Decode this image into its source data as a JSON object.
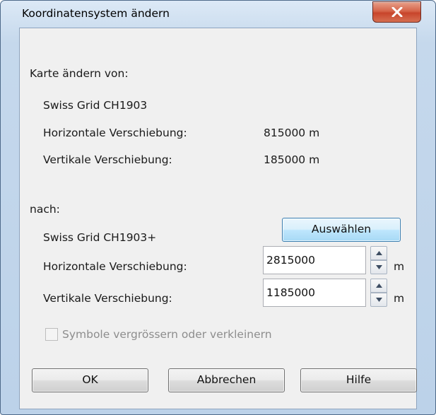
{
  "window": {
    "title": "Koordinatensystem ändern",
    "close_icon": "close-x-icon"
  },
  "from": {
    "heading": "Karte ändern von:",
    "system_name": "Swiss Grid  CH1903",
    "horizontal_label": "Horizontale Verschiebung:",
    "horizontal_value": "815000 m",
    "vertical_label": "Vertikale Verschiebung:",
    "vertical_value": "185000 m"
  },
  "to": {
    "heading": "nach:",
    "system_name": "Swiss Grid  CH1903+",
    "select_button": "Auswählen",
    "horizontal_label": "Horizontale Verschiebung:",
    "horizontal_value": "2815000",
    "horizontal_unit": "m",
    "vertical_label": "Vertikale Verschiebung:",
    "vertical_value": "1185000",
    "vertical_unit": "m"
  },
  "scale_symbols": {
    "label": "Symbole vergrössern oder verkleinern",
    "checked": false,
    "enabled": false
  },
  "buttons": {
    "ok": "OK",
    "cancel": "Abbrechen",
    "help": "Hilfe"
  }
}
